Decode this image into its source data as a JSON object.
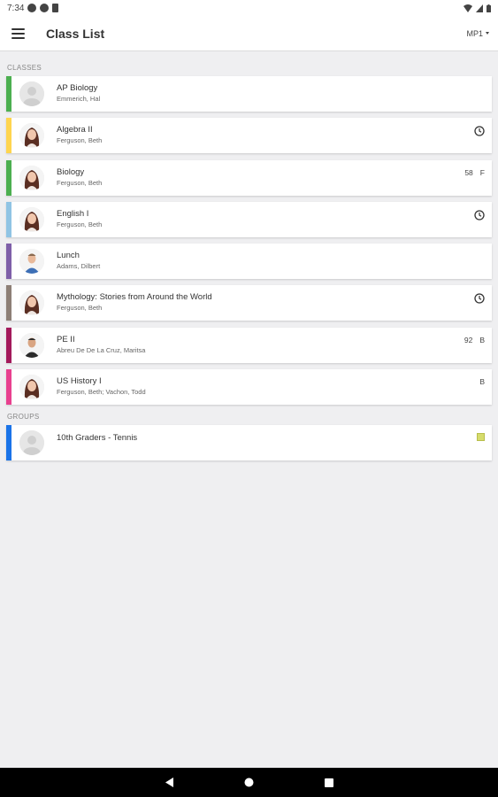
{
  "status_bar": {
    "time": "7:34"
  },
  "app_bar": {
    "title": "Class List",
    "period": "MP1"
  },
  "sections": {
    "classes_label": "CLASSES",
    "groups_label": "GROUPS"
  },
  "classes": [
    {
      "name": "AP Biology",
      "teacher": "Emmerich, Hal",
      "stripe": "#4caf50",
      "avatar": "placeholder",
      "grade_num": "",
      "grade_letter": "",
      "icon": ""
    },
    {
      "name": "Algebra II",
      "teacher": "Ferguson, Beth",
      "stripe": "#ffd54f",
      "avatar": "woman",
      "grade_num": "",
      "grade_letter": "",
      "icon": "clock-icon"
    },
    {
      "name": "Biology",
      "teacher": "Ferguson, Beth",
      "stripe": "#4caf50",
      "avatar": "woman",
      "grade_num": "58",
      "grade_letter": "F",
      "icon": ""
    },
    {
      "name": "English I",
      "teacher": "Ferguson, Beth",
      "stripe": "#90c4e4",
      "avatar": "woman",
      "grade_num": "",
      "grade_letter": "",
      "icon": "clock-icon"
    },
    {
      "name": "Lunch",
      "teacher": "Adams, Dilbert",
      "stripe": "#7e5fa8",
      "avatar": "man-blue",
      "grade_num": "",
      "grade_letter": "",
      "icon": ""
    },
    {
      "name": "Mythology: Stories from Around the World",
      "teacher": "Ferguson, Beth",
      "stripe": "#8d7f76",
      "avatar": "woman",
      "grade_num": "",
      "grade_letter": "",
      "icon": "clock-icon"
    },
    {
      "name": "PE II",
      "teacher": "Abreu De De La Cruz, Maritsa",
      "stripe": "#a3195b",
      "avatar": "man-dark",
      "grade_num": "92",
      "grade_letter": "B",
      "icon": ""
    },
    {
      "name": "US History I",
      "teacher": "Ferguson, Beth; Vachon, Todd",
      "stripe": "#e8408f",
      "avatar": "woman",
      "grade_num": "",
      "grade_letter": "B",
      "icon": ""
    }
  ],
  "groups": [
    {
      "name": "10th Graders - Tennis",
      "teacher": "",
      "stripe": "#1a73e8",
      "avatar": "placeholder",
      "grade_num": "",
      "grade_letter": "",
      "icon": "note-icon"
    }
  ]
}
